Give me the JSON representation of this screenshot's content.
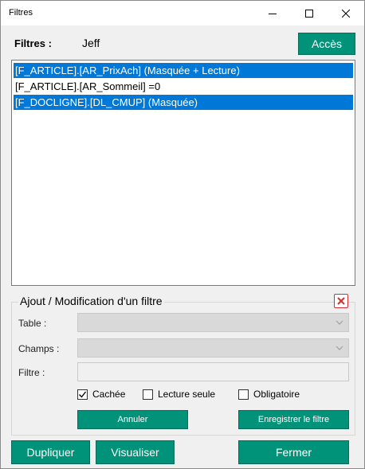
{
  "window": {
    "title": "Filtres"
  },
  "header": {
    "label": "Filtres :",
    "user": "Jeff",
    "access_button": "Accès"
  },
  "filters": [
    {
      "text": "[F_ARTICLE].[AR_PrixAch] (Masquée + Lecture)",
      "selected": true
    },
    {
      "text": "[F_ARTICLE].[AR_Sommeil] =0",
      "selected": false
    },
    {
      "text": "[F_DOCLIGNE].[DL_CMUP] (Masquée)",
      "selected": true
    }
  ],
  "edit_group": {
    "title": "Ajout / Modification d'un filtre",
    "table_label": "Table :",
    "table_value": "",
    "fields_label": "Champs :",
    "fields_value": "",
    "filter_label": "Filtre :",
    "filter_value": "",
    "checkboxes": [
      {
        "label": "Cachée",
        "checked": true
      },
      {
        "label": "Lecture seule",
        "checked": false
      },
      {
        "label": "Obligatoire",
        "checked": false
      }
    ],
    "cancel_button": "Annuler",
    "save_button": "Enregistrer le filtre"
  },
  "footer": {
    "duplicate_button": "Dupliquer",
    "view_button": "Visualiser",
    "close_button": "Fermer"
  },
  "colors": {
    "accent": "#00937a",
    "selection": "#0078d7",
    "close_red": "#d03030"
  }
}
